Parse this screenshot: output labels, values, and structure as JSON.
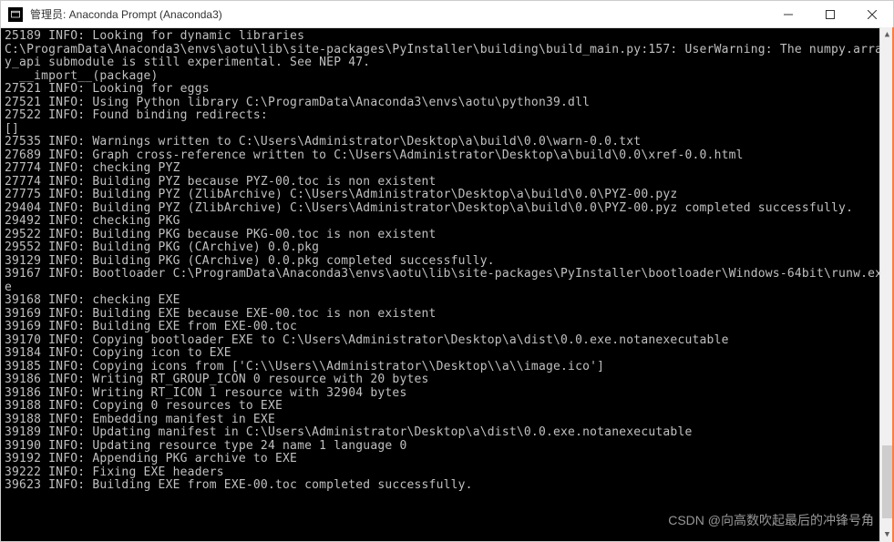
{
  "window": {
    "title": "管理员: Anaconda Prompt (Anaconda3)"
  },
  "terminal": {
    "lines": [
      "25189 INFO: Looking for dynamic libraries",
      "C:\\ProgramData\\Anaconda3\\envs\\aotu\\lib\\site-packages\\PyInstaller\\building\\build_main.py:157: UserWarning: The numpy.arra",
      "y_api submodule is still experimental. See NEP 47.",
      "  __import__(package)",
      "27521 INFO: Looking for eggs",
      "27521 INFO: Using Python library C:\\ProgramData\\Anaconda3\\envs\\aotu\\python39.dll",
      "27522 INFO: Found binding redirects:",
      "[]",
      "27535 INFO: Warnings written to C:\\Users\\Administrator\\Desktop\\a\\build\\0.0\\warn-0.0.txt",
      "27689 INFO: Graph cross-reference written to C:\\Users\\Administrator\\Desktop\\a\\build\\0.0\\xref-0.0.html",
      "27774 INFO: checking PYZ",
      "27774 INFO: Building PYZ because PYZ-00.toc is non existent",
      "27775 INFO: Building PYZ (ZlibArchive) C:\\Users\\Administrator\\Desktop\\a\\build\\0.0\\PYZ-00.pyz",
      "29404 INFO: Building PYZ (ZlibArchive) C:\\Users\\Administrator\\Desktop\\a\\build\\0.0\\PYZ-00.pyz completed successfully.",
      "29492 INFO: checking PKG",
      "29522 INFO: Building PKG because PKG-00.toc is non existent",
      "29552 INFO: Building PKG (CArchive) 0.0.pkg",
      "39129 INFO: Building PKG (CArchive) 0.0.pkg completed successfully.",
      "39167 INFO: Bootloader C:\\ProgramData\\Anaconda3\\envs\\aotu\\lib\\site-packages\\PyInstaller\\bootloader\\Windows-64bit\\runw.ex",
      "e",
      "39168 INFO: checking EXE",
      "39169 INFO: Building EXE because EXE-00.toc is non existent",
      "39169 INFO: Building EXE from EXE-00.toc",
      "39170 INFO: Copying bootloader EXE to C:\\Users\\Administrator\\Desktop\\a\\dist\\0.0.exe.notanexecutable",
      "39184 INFO: Copying icon to EXE",
      "39185 INFO: Copying icons from ['C:\\\\Users\\\\Administrator\\\\Desktop\\\\a\\\\image.ico']",
      "39186 INFO: Writing RT_GROUP_ICON 0 resource with 20 bytes",
      "39186 INFO: Writing RT_ICON 1 resource with 32904 bytes",
      "39188 INFO: Copying 0 resources to EXE",
      "39188 INFO: Embedding manifest in EXE",
      "39189 INFO: Updating manifest in C:\\Users\\Administrator\\Desktop\\a\\dist\\0.0.exe.notanexecutable",
      "39190 INFO: Updating resource type 24 name 1 language 0",
      "39192 INFO: Appending PKG archive to EXE",
      "39222 INFO: Fixing EXE headers",
      "39623 INFO: Building EXE from EXE-00.toc completed successfully."
    ]
  },
  "watermark": {
    "text": "CSDN @向高数吹起最后的冲锋号角"
  }
}
